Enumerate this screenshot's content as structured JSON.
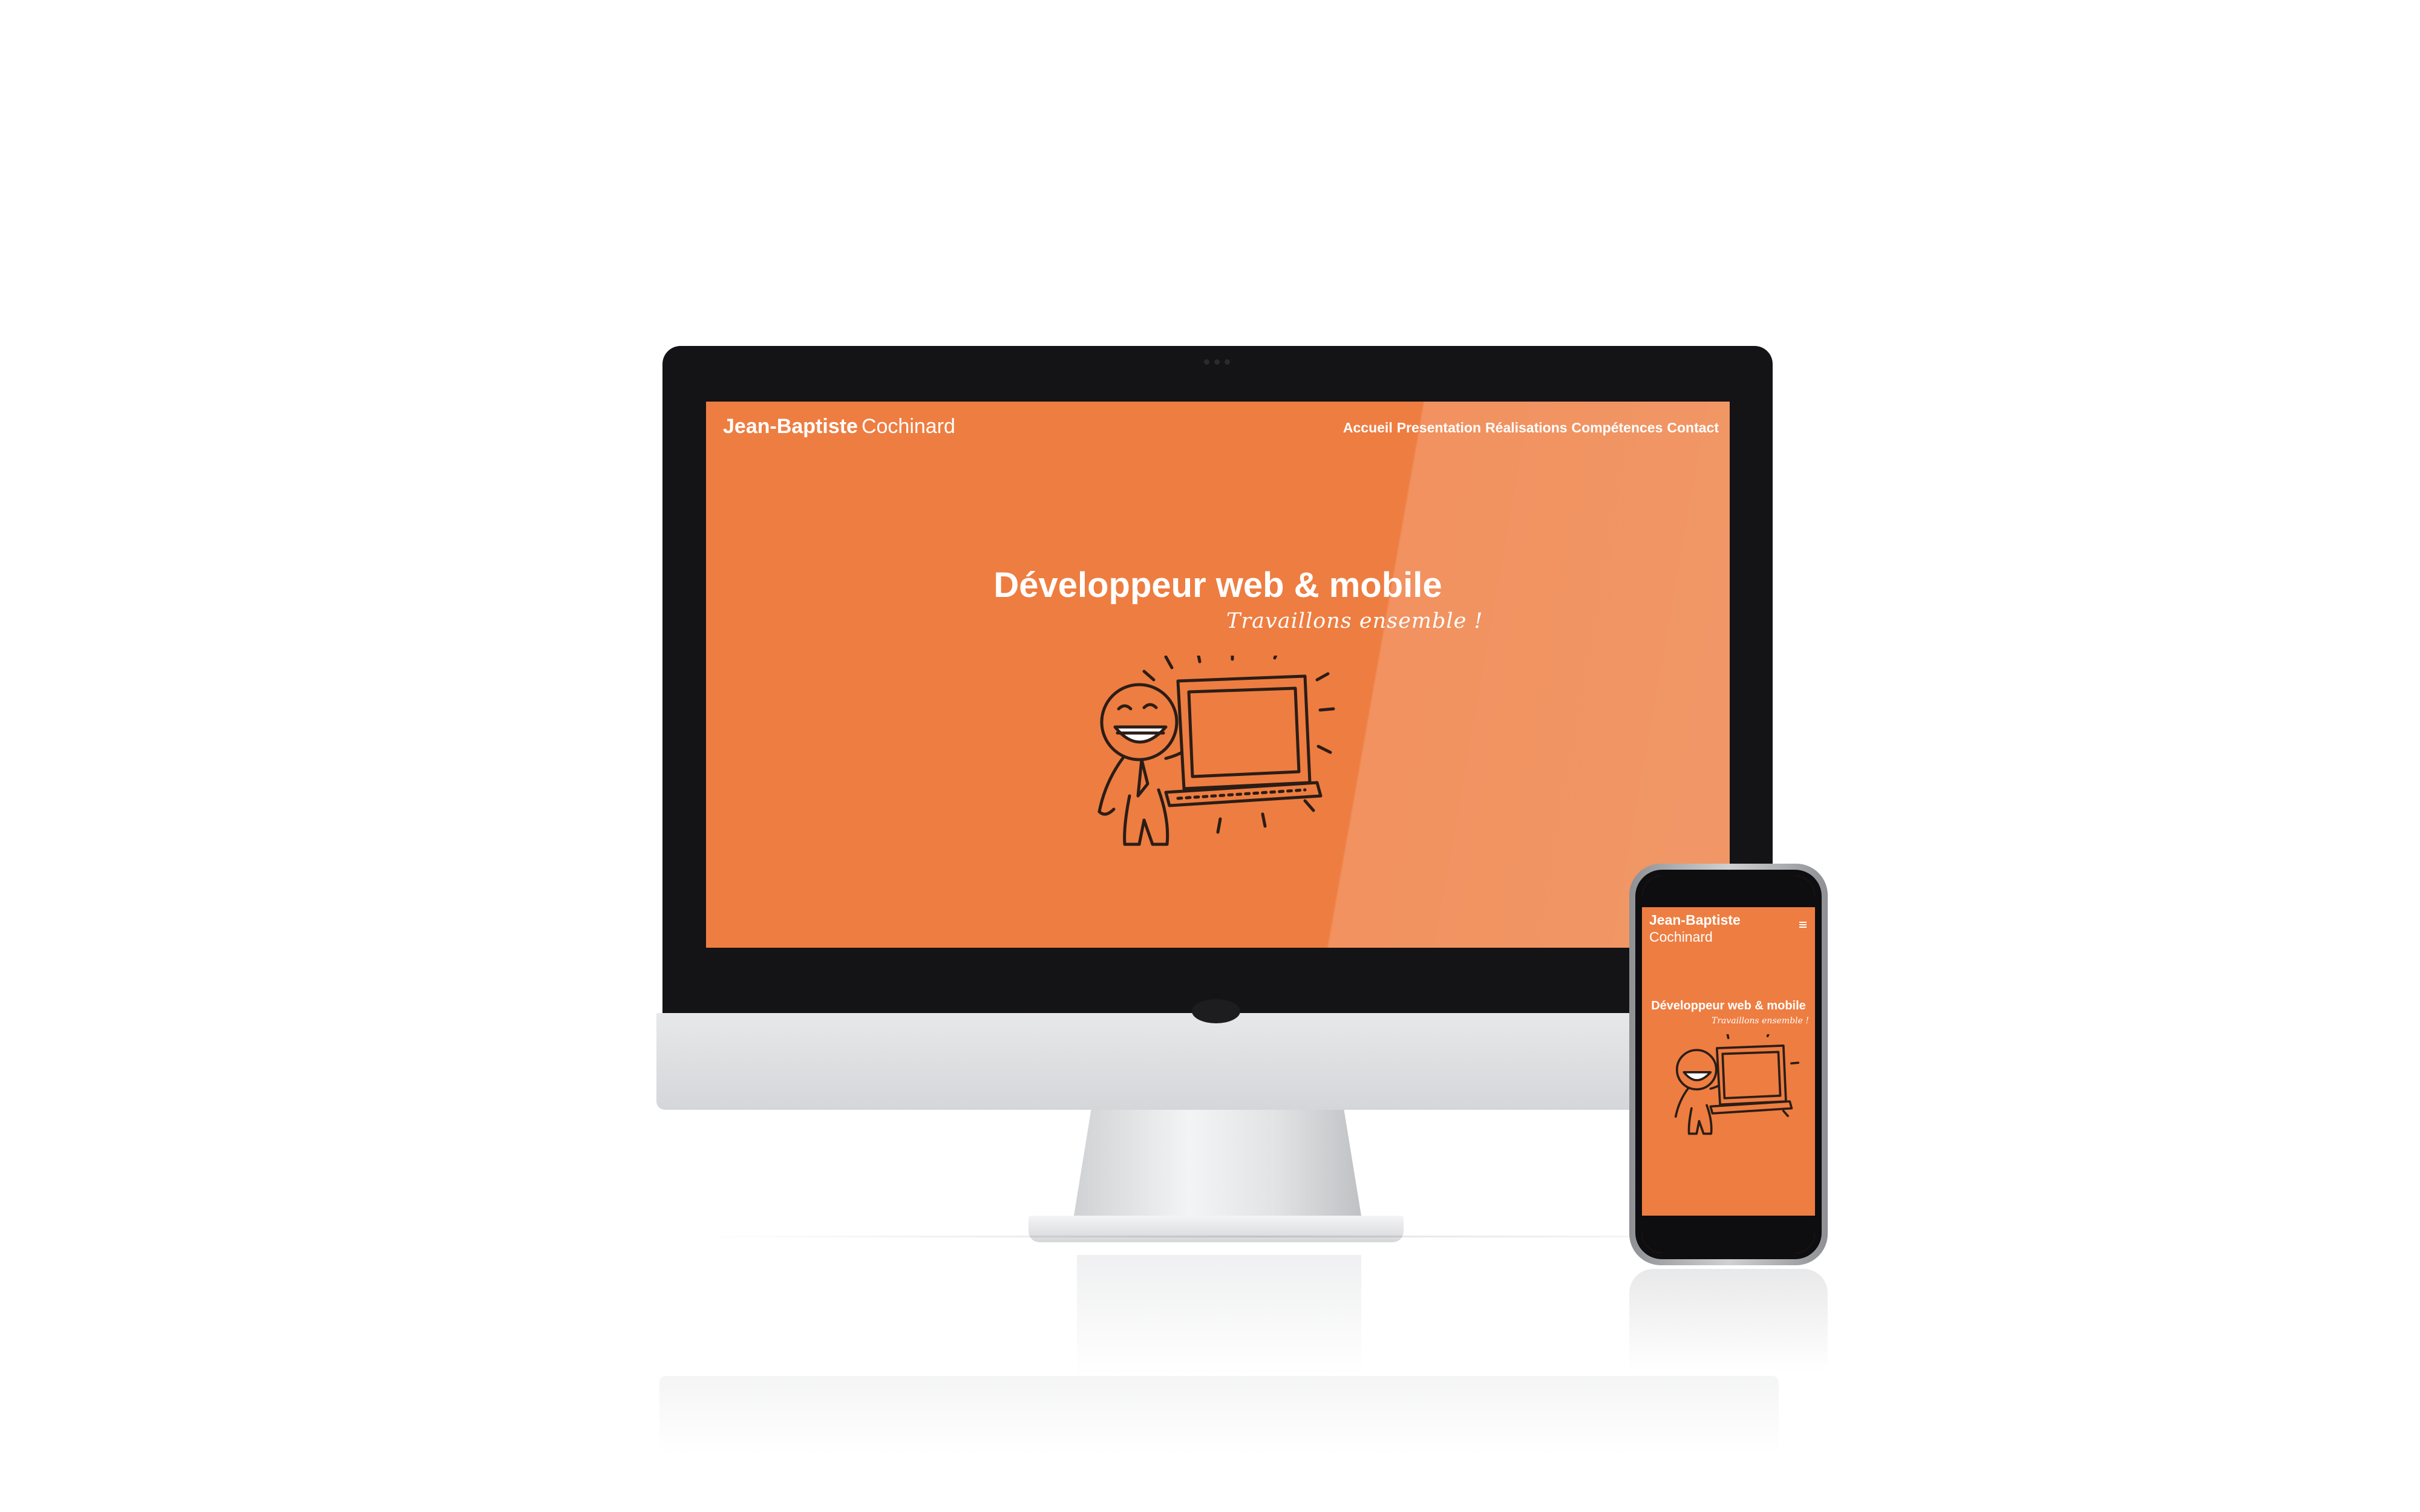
{
  "desktop": {
    "brand": {
      "first": "Jean-Baptiste",
      "last": "Cochinard"
    },
    "nav": [
      "Accueil",
      "Presentation",
      "Réalisations",
      "Compétences",
      "Contact"
    ],
    "hero": {
      "title": "Développeur web & mobile",
      "subtitle": "Travaillons ensemble !"
    }
  },
  "mobile": {
    "brand": {
      "first": "Jean-Baptiste",
      "last": "Cochinard"
    },
    "hero": {
      "title": "Développeur web & mobile",
      "subtitle": "Travaillons ensemble !"
    },
    "menu_icon": "hamburger-icon"
  },
  "colors": {
    "accent": "#ee7d41",
    "text": "#ffffff",
    "bezel": "#141416"
  }
}
